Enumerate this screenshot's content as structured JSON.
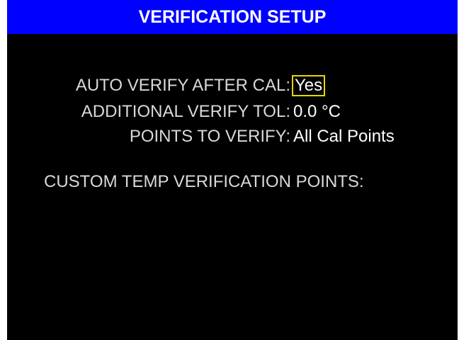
{
  "header": {
    "title": "VERIFICATION SETUP",
    "background_color": "#0000ff",
    "text_color": "#ffffff"
  },
  "settings": [
    {
      "label": "AUTO VERIFY AFTER CAL:",
      "value": "Yes",
      "selected": true
    },
    {
      "label": "ADDITIONAL VERIFY TOL:",
      "value": "0.0 °C",
      "selected": false
    },
    {
      "label": "POINTS TO VERIFY:",
      "value": "All Cal Points",
      "selected": false
    }
  ],
  "custom_points": {
    "label": "CUSTOM TEMP VERIFICATION POINTS:"
  },
  "colors": {
    "screen_background": "#000000",
    "selection_border": "#e5d800"
  }
}
